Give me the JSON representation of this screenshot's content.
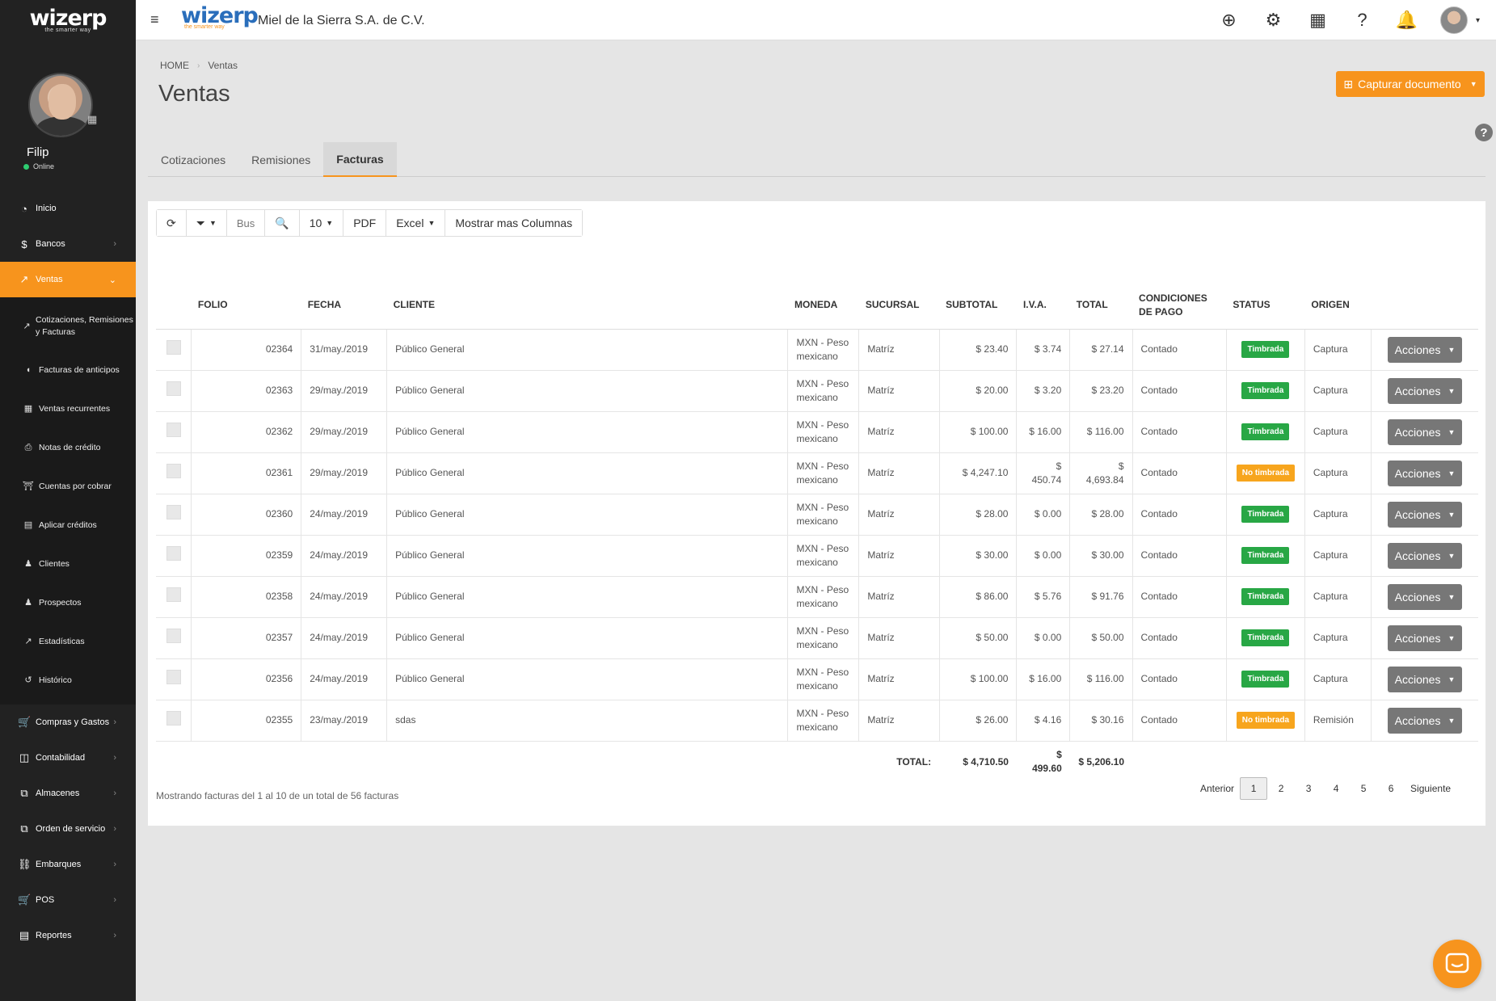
{
  "sidebar": {
    "logo": "wizerp",
    "logo_tag": "the smarter way",
    "user_name": "Filip",
    "user_status": "Online",
    "menu": [
      {
        "label": "Inicio",
        "icon": "dashboard-icon"
      },
      {
        "label": "Bancos",
        "icon": "dollar-icon"
      },
      {
        "label": "Ventas",
        "icon": "chart-icon"
      }
    ],
    "submenu": [
      {
        "label": "Cotizaciones, Remisiones y Facturas",
        "icon": "chart-icon"
      },
      {
        "label": "Facturas de anticipos",
        "icon": "receipt-icon"
      },
      {
        "label": "Ventas recurrentes",
        "icon": "calendar-icon"
      },
      {
        "label": "Notas de crédito",
        "icon": "credit-note-icon"
      },
      {
        "label": "Cuentas por cobrar",
        "icon": "bank-icon"
      },
      {
        "label": "Aplicar créditos",
        "icon": "calculator-icon"
      },
      {
        "label": "Clientes",
        "icon": "users-icon"
      },
      {
        "label": "Prospectos",
        "icon": "users-icon"
      },
      {
        "label": "Estadísticas",
        "icon": "chart-icon"
      },
      {
        "label": "Histórico",
        "icon": "history-icon"
      }
    ],
    "lower_menu": [
      {
        "label": "Compras y Gastos",
        "icon": "cart-icon"
      },
      {
        "label": "Contabilidad",
        "icon": "money-icon"
      },
      {
        "label": "Almacenes",
        "icon": "copy-icon"
      },
      {
        "label": "Orden de servicio",
        "icon": "copy-icon"
      },
      {
        "label": "Embarques",
        "icon": "truck-icon"
      },
      {
        "label": "POS",
        "icon": "cart-icon"
      },
      {
        "label": "Reportes",
        "icon": "list-icon"
      }
    ]
  },
  "header": {
    "brand": "wizerp",
    "brand_tag": "the smarter way",
    "company": "Miel de la Sierra S.A. de C.V."
  },
  "page": {
    "breadcrumb": [
      "HOME",
      "Ventas"
    ],
    "title": "Ventas",
    "capture_button": "Capturar documento",
    "tabs": [
      "Cotizaciones",
      "Remisiones",
      "Facturas"
    ],
    "active_tab": "Facturas"
  },
  "toolbar": {
    "search_placeholder": "Bus",
    "page_size": "10",
    "pdf": "PDF",
    "excel": "Excel",
    "more_columns": "Mostrar mas Columnas"
  },
  "table": {
    "columns": [
      "FOLIO",
      "FECHA",
      "CLIENTE",
      "MONEDA",
      "SUCURSAL",
      "SUBTOTAL",
      "I.V.A.",
      "TOTAL",
      "CONDICIONES DE PAGO",
      "STATUS",
      "ORIGEN"
    ],
    "rows": [
      {
        "folio": "02364",
        "fecha": "31/may./2019",
        "cliente": "Público General",
        "moneda": "MXN - Peso mexicano",
        "sucursal": "Matríz",
        "subtotal": "$ 23.40",
        "iva": "$ 3.74",
        "total": "$ 27.14",
        "condiciones": "Contado",
        "status": "Timbrada",
        "origen": "Captura"
      },
      {
        "folio": "02363",
        "fecha": "29/may./2019",
        "cliente": "Público General",
        "moneda": "MXN - Peso mexicano",
        "sucursal": "Matríz",
        "subtotal": "$ 20.00",
        "iva": "$ 3.20",
        "total": "$ 23.20",
        "condiciones": "Contado",
        "status": "Timbrada",
        "origen": "Captura"
      },
      {
        "folio": "02362",
        "fecha": "29/may./2019",
        "cliente": "Público General",
        "moneda": "MXN - Peso mexicano",
        "sucursal": "Matríz",
        "subtotal": "$ 100.00",
        "iva": "$ 16.00",
        "total": "$ 116.00",
        "condiciones": "Contado",
        "status": "Timbrada",
        "origen": "Captura"
      },
      {
        "folio": "02361",
        "fecha": "29/may./2019",
        "cliente": "Público General",
        "moneda": "MXN - Peso mexicano",
        "sucursal": "Matríz",
        "subtotal": "$ 4,247.10",
        "iva": "$ 450.74",
        "total": "$ 4,693.84",
        "condiciones": "Contado",
        "status": "No timbrada",
        "origen": "Captura"
      },
      {
        "folio": "02360",
        "fecha": "24/may./2019",
        "cliente": "Público General",
        "moneda": "MXN - Peso mexicano",
        "sucursal": "Matríz",
        "subtotal": "$ 28.00",
        "iva": "$ 0.00",
        "total": "$ 28.00",
        "condiciones": "Contado",
        "status": "Timbrada",
        "origen": "Captura"
      },
      {
        "folio": "02359",
        "fecha": "24/may./2019",
        "cliente": "Público General",
        "moneda": "MXN - Peso mexicano",
        "sucursal": "Matríz",
        "subtotal": "$ 30.00",
        "iva": "$ 0.00",
        "total": "$ 30.00",
        "condiciones": "Contado",
        "status": "Timbrada",
        "origen": "Captura"
      },
      {
        "folio": "02358",
        "fecha": "24/may./2019",
        "cliente": "Público General",
        "moneda": "MXN - Peso mexicano",
        "sucursal": "Matríz",
        "subtotal": "$ 86.00",
        "iva": "$ 5.76",
        "total": "$ 91.76",
        "condiciones": "Contado",
        "status": "Timbrada",
        "origen": "Captura"
      },
      {
        "folio": "02357",
        "fecha": "24/may./2019",
        "cliente": "Público General",
        "moneda": "MXN - Peso mexicano",
        "sucursal": "Matríz",
        "subtotal": "$ 50.00",
        "iva": "$ 0.00",
        "total": "$ 50.00",
        "condiciones": "Contado",
        "status": "Timbrada",
        "origen": "Captura"
      },
      {
        "folio": "02356",
        "fecha": "24/may./2019",
        "cliente": "Público General",
        "moneda": "MXN - Peso mexicano",
        "sucursal": "Matríz",
        "subtotal": "$ 100.00",
        "iva": "$ 16.00",
        "total": "$ 116.00",
        "condiciones": "Contado",
        "status": "Timbrada",
        "origen": "Captura"
      },
      {
        "folio": "02355",
        "fecha": "23/may./2019",
        "cliente": "sdas",
        "moneda": "MXN - Peso mexicano",
        "sucursal": "Matríz",
        "subtotal": "$ 26.00",
        "iva": "$ 4.16",
        "total": "$ 30.16",
        "condiciones": "Contado",
        "status": "No timbrada",
        "origen": "Remisión"
      }
    ],
    "actions_label": "Acciones",
    "totals": {
      "label": "TOTAL:",
      "subtotal": "$ 4,710.50",
      "iva": "$ 499.60",
      "total": "$ 5,206.10"
    }
  },
  "footer": {
    "info": "Mostrando facturas del 1 al 10 de un total de 56 facturas",
    "prev": "Anterior",
    "pages": [
      "1",
      "2",
      "3",
      "4",
      "5",
      "6"
    ],
    "current_page": "1",
    "next": "Siguiente"
  },
  "colors": {
    "accent": "#f7941d",
    "sidebar": "#222222",
    "brand_blue": "#2a6ebb",
    "status_timbrada": "#28a745",
    "status_no_timbrada": "#f7a51d"
  }
}
